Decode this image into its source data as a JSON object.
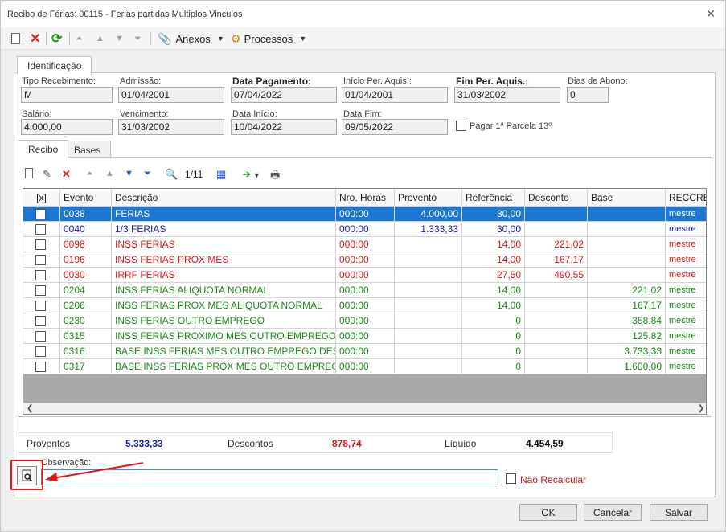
{
  "window": {
    "title": "Recibo de Férias: 00115 - Ferias partidas Multiplos Vinculos",
    "close_glyph": "✕"
  },
  "toolbar": {
    "anexos": "Anexos",
    "processos": "Processos"
  },
  "tabs": {
    "identificacao": "Identificação",
    "recibo": "Recibo",
    "bases": "Bases"
  },
  "fields": {
    "tipo_recebimento": {
      "label": "Tipo Recebimento:",
      "value": "M"
    },
    "admissao": {
      "label": "Admissão:",
      "value": "01/04/2001"
    },
    "data_pagamento": {
      "label": "Data Pagamento:",
      "value": "07/04/2022"
    },
    "inicio_per_aquis": {
      "label": "Início Per. Aquis.:",
      "value": "01/04/2001"
    },
    "fim_per_aquis": {
      "label": "Fim Per. Aquis.:",
      "value": "31/03/2002"
    },
    "dias_abono": {
      "label": "Dias de Abono:",
      "value": "0"
    },
    "salario": {
      "label": "Salário:",
      "value": "4.000,00"
    },
    "vencimento": {
      "label": "Vencimento:",
      "value": "31/03/2002"
    },
    "data_inicio": {
      "label": "Data Início:",
      "value": "10/04/2022"
    },
    "data_fim": {
      "label": "Data Fim:",
      "value": "09/05/2022"
    },
    "pagar_parcela": {
      "label": "Pagar 1ª Parcela 13º"
    }
  },
  "grid": {
    "pager": "1/11",
    "headers": [
      "[x]",
      "Evento",
      "Descrição",
      "Nro. Horas",
      "Provento",
      "Referência",
      "Desconto",
      "Base",
      "RECCRE"
    ],
    "rows": [
      {
        "evento": "0038",
        "descricao": "FERIAS",
        "horas": "000:00",
        "provento": "4.000,00",
        "referencia": "30,00",
        "desconto": "",
        "base": "",
        "reccre": "mestre",
        "color": "#ffffff"
      },
      {
        "evento": "0040",
        "descricao": "1/3 FERIAS",
        "horas": "000:00",
        "provento": "1.333,33",
        "referencia": "30,00",
        "desconto": "",
        "base": "",
        "reccre": "mestre",
        "color": "#1a1ab4"
      },
      {
        "evento": "0098",
        "descricao": "INSS FERIAS",
        "horas": "000:00",
        "provento": "",
        "referencia": "14,00",
        "desconto": "221,02",
        "base": "",
        "reccre": "mestre",
        "color": "#e01818"
      },
      {
        "evento": "0196",
        "descricao": "INSS FERIAS PROX MES",
        "horas": "000:00",
        "provento": "",
        "referencia": "14,00",
        "desconto": "167,17",
        "base": "",
        "reccre": "mestre",
        "color": "#e01818"
      },
      {
        "evento": "0030",
        "descricao": "IRRF FERIAS",
        "horas": "000:00",
        "provento": "",
        "referencia": "27,50",
        "desconto": "490,55",
        "base": "",
        "reccre": "mestre",
        "color": "#e01818"
      },
      {
        "evento": "0204",
        "descricao": "INSS FERIAS ALIQUOTA NORMAL",
        "horas": "000:00",
        "provento": "",
        "referencia": "14,00",
        "desconto": "",
        "base": "221,02",
        "reccre": "mestre",
        "color": "#1a8a1a"
      },
      {
        "evento": "0206",
        "descricao": "INSS FERIAS PROX MES ALIQUOTA NORMAL",
        "horas": "000:00",
        "provento": "",
        "referencia": "14,00",
        "desconto": "",
        "base": "167,17",
        "reccre": "mestre",
        "color": "#1a8a1a"
      },
      {
        "evento": "0230",
        "descricao": "INSS FERIAS OUTRO EMPREGO",
        "horas": "000:00",
        "provento": "",
        "referencia": "0",
        "desconto": "",
        "base": "358,84",
        "reccre": "mestre",
        "color": "#1a8a1a"
      },
      {
        "evento": "0315",
        "descricao": "INSS FERIAS PROXIMO MES OUTRO EMPREGO",
        "horas": "000:00",
        "provento": "",
        "referencia": "0",
        "desconto": "",
        "base": "125,82",
        "reccre": "mestre",
        "color": "#1a8a1a"
      },
      {
        "evento": "0316",
        "descricao": "BASE INSS FERIAS MES OUTRO EMPREGO DESC. ...",
        "horas": "000:00",
        "provento": "",
        "referencia": "0",
        "desconto": "",
        "base": "3.733,33",
        "reccre": "mestre",
        "color": "#1a8a1a"
      },
      {
        "evento": "0317",
        "descricao": "BASE INSS FERIAS PROX MES OUTRO EMPREGO ...",
        "horas": "000:00",
        "provento": "",
        "referencia": "0",
        "desconto": "",
        "base": "1.600,00",
        "reccre": "mestre",
        "color": "#1a8a1a"
      }
    ]
  },
  "totals": {
    "proventos_label": "Proventos",
    "proventos_value": "5.333,33",
    "descontos_label": "Descontos",
    "descontos_value": "878,74",
    "liquido_label": "Líquido",
    "liquido_value": "4.454,59"
  },
  "observacao": {
    "label": "Observação:",
    "nao_recalcular": "Não Recalcular"
  },
  "buttons": {
    "ok": "OK",
    "cancelar": "Cancelar",
    "salvar": "Salvar"
  },
  "colors": {
    "selection": "#1a78d4",
    "accent_red": "#e01818",
    "provento_blue": "#1a1ab4"
  }
}
